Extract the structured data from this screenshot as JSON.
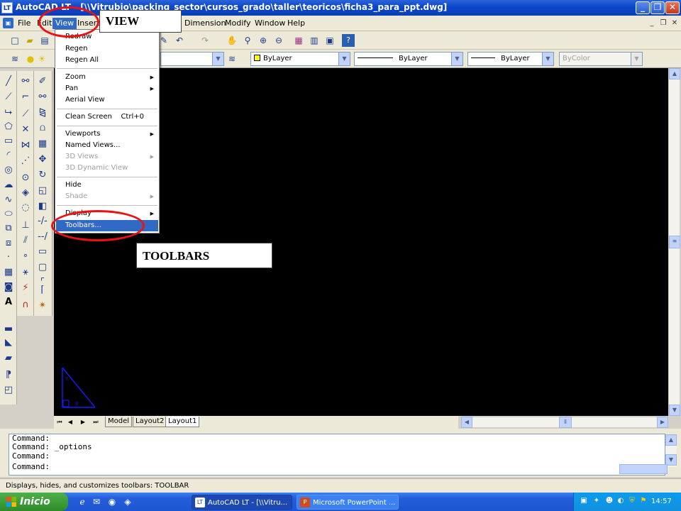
{
  "window": {
    "app_icon_label": "LT",
    "title": "AutoCAD LT - [\\\\Vitrubio\\packing_sector\\cursos_grado\\taller\\teoricos\\ficha3_para_ppt.dwg]",
    "minimize": "_",
    "restore": "❐",
    "close": "✕"
  },
  "menubar": {
    "items": [
      "File",
      "Edit",
      "View",
      "Insert",
      "Dimension",
      "Modify",
      "Window",
      "Help"
    ],
    "active": "View"
  },
  "properties_toolbar": {
    "layer_value": "",
    "color_value": "ByLayer",
    "linetype_value": "ByLayer",
    "lineweight_value": "ByLayer",
    "plotstyle_value": "ByColor"
  },
  "view_menu": {
    "items": [
      {
        "label": "Redraw",
        "enabled": true
      },
      {
        "label": "Regen",
        "enabled": true
      },
      {
        "label": "Regen All",
        "enabled": true
      },
      {
        "label": "Zoom",
        "enabled": true,
        "submenu": true
      },
      {
        "label": "Pan",
        "enabled": true,
        "submenu": true
      },
      {
        "label": "Aerial View",
        "enabled": true
      },
      {
        "label": "Clean Screen",
        "enabled": true,
        "shortcut": "Ctrl+0"
      },
      {
        "label": "Viewports",
        "enabled": true,
        "submenu": true
      },
      {
        "label": "Named Views...",
        "enabled": true
      },
      {
        "label": "3D Views",
        "enabled": false,
        "submenu": true
      },
      {
        "label": "3D Dynamic View",
        "enabled": false
      },
      {
        "label": "Hide",
        "enabled": true
      },
      {
        "label": "Shade",
        "enabled": false,
        "submenu": true
      },
      {
        "label": "Display",
        "enabled": true,
        "submenu": true
      },
      {
        "label": "Toolbars...",
        "enabled": true,
        "highlighted": true
      }
    ]
  },
  "annotations": {
    "view_callout": "VIEW",
    "toolbars_callout": "TOOLBARS",
    "ring_color": "#e11111"
  },
  "layout_tabs": [
    "Model",
    "Layout2",
    "Layout1"
  ],
  "active_layout": "Layout1",
  "command_history": [
    "Command:",
    "Command:  _options",
    "Command:"
  ],
  "command_prompt": "Command:",
  "status_text": "Displays, hides, and customizes toolbars:  TOOLBAR",
  "taskbar": {
    "start_label": "Inicio",
    "buttons": [
      {
        "label": "AutoCAD LT - [\\\\Vitru...",
        "icon": "LT",
        "pressed": true
      },
      {
        "label": "Microsoft PowerPoint ...",
        "icon": "P",
        "pressed": false
      }
    ],
    "clock": "14:57"
  },
  "colors": {
    "titlebar": "#0a46c8",
    "canvas": "#000000",
    "highlight": "#316ac5",
    "ucs_icon": "#1a1aff"
  }
}
